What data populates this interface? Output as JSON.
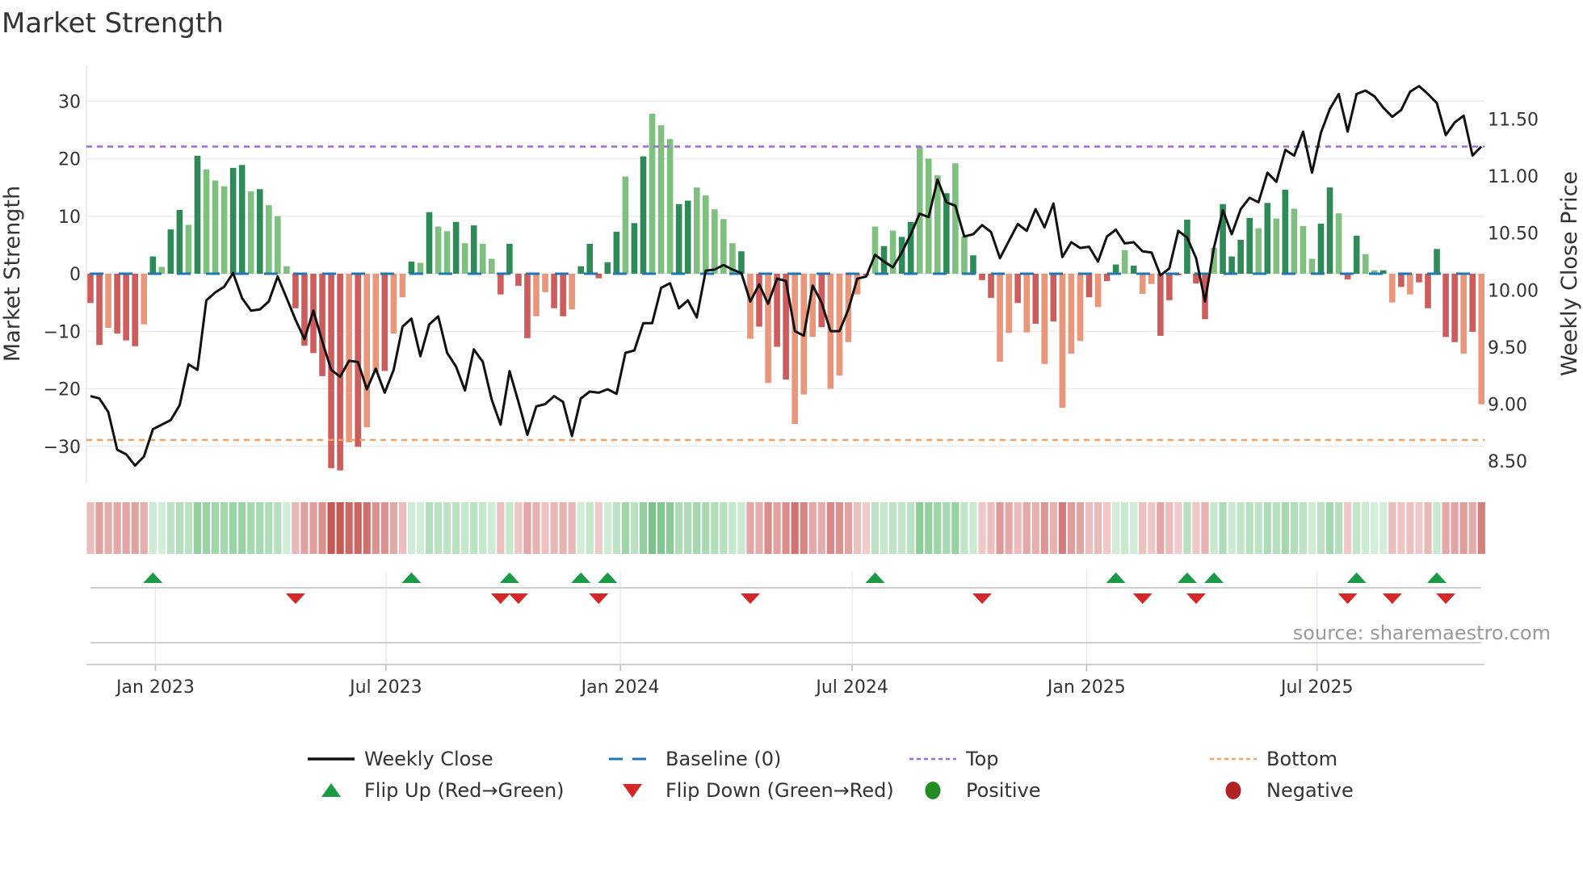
{
  "title": "Market Strength",
  "source": "source: sharemaestro.com",
  "colors": {
    "bar_pos_dark": "#2e8b57",
    "bar_pos_light": "#7fbf7f",
    "bar_neg_dark": "#cd5c5c",
    "bar_neg_light": "#e9967a",
    "close_line": "#111111",
    "baseline": "#1f77b4",
    "top": "#a066e0",
    "bottom": "#f4a460",
    "flip_up": "#1a9a45",
    "flip_down": "#d62728",
    "positive": "#228b22",
    "negative": "#b22222"
  },
  "legend": [
    {
      "key": "weekly_close",
      "label": "Weekly Close"
    },
    {
      "key": "baseline",
      "label": "Baseline (0)"
    },
    {
      "key": "top",
      "label": "Top"
    },
    {
      "key": "bottom",
      "label": "Bottom"
    },
    {
      "key": "flip_up",
      "label": "Flip Up (Red→Green)"
    },
    {
      "key": "flip_down",
      "label": "Flip Down (Green→Red)"
    },
    {
      "key": "positive",
      "label": "Positive"
    },
    {
      "key": "negative",
      "label": "Negative"
    }
  ],
  "chart_data": {
    "type": "bar",
    "title": "Market Strength",
    "ylabel": "Market Strength",
    "y2label": "Weekly Close Price",
    "ylim": [
      -36.5,
      36.5
    ],
    "y2lim": [
      8.3,
      11.9
    ],
    "start_date": "2022-11-11",
    "interval": "weekly",
    "top_level": 22.1,
    "bottom_level": -28.9,
    "baseline": 0,
    "yticks": [
      {
        "v": 30,
        "label": "30"
      },
      {
        "v": 20,
        "label": "20"
      },
      {
        "v": 10,
        "label": "10"
      },
      {
        "v": 0,
        "label": "0"
      },
      {
        "v": -10,
        "label": "−10"
      },
      {
        "v": -20,
        "label": "−20"
      },
      {
        "v": -30,
        "label": "−30"
      }
    ],
    "y2ticks": [
      {
        "v": 11.5,
        "label": "11.50"
      },
      {
        "v": 11.0,
        "label": "11.00"
      },
      {
        "v": 10.5,
        "label": "10.50"
      },
      {
        "v": 10.0,
        "label": "10.00"
      },
      {
        "v": 9.5,
        "label": "9.50"
      },
      {
        "v": 9.0,
        "label": "9.00"
      },
      {
        "v": 8.5,
        "label": "8.50"
      }
    ],
    "xticks": [
      {
        "date": "2023-01-01",
        "label": "Jan 2023"
      },
      {
        "date": "2023-07-01",
        "label": "Jul 2023"
      },
      {
        "date": "2024-01-01",
        "label": "Jan 2024"
      },
      {
        "date": "2024-07-01",
        "label": "Jul 2024"
      },
      {
        "date": "2025-01-01",
        "label": "Jan 2025"
      },
      {
        "date": "2025-07-01",
        "label": "Jul 2025"
      }
    ],
    "strength": [
      -5.1,
      -12.4,
      -9.4,
      -10.4,
      -11.6,
      -12.6,
      -8.8,
      3.0,
      1.2,
      7.7,
      11.1,
      8.5,
      20.5,
      18.1,
      16.2,
      15.2,
      18.4,
      18.9,
      14.3,
      14.7,
      11.9,
      10.0,
      1.3,
      -6.0,
      -12.5,
      -13.8,
      -17.8,
      -33.8,
      -34.2,
      -29.3,
      -30.1,
      -26.7,
      -17.0,
      -16.9,
      -10.4,
      -4.1,
      2.1,
      1.9,
      10.7,
      8.2,
      7.4,
      9.0,
      5.3,
      8.4,
      5.2,
      2.6,
      -3.6,
      5.2,
      -2.1,
      -11.2,
      -7.4,
      -3.2,
      -6.0,
      -7.4,
      -6.2,
      1.3,
      5.2,
      -0.8,
      2.0,
      7.3,
      16.9,
      8.8,
      20.4,
      27.8,
      25.8,
      23.4,
      12.1,
      12.7,
      15.0,
      13.6,
      11.2,
      9.5,
      5.3,
      3.9,
      -11.3,
      -9.2,
      -19.0,
      -12.7,
      -18.4,
      -26.1,
      -21.0,
      -11.0,
      -9.3,
      -20.0,
      -17.7,
      -11.9,
      -3.6,
      -0.3,
      8.2,
      4.8,
      7.5,
      6.4,
      9.0,
      22.1,
      20.0,
      17.1,
      14.0,
      19.2,
      6.5,
      3.2,
      -1.1,
      -4.2,
      -15.3,
      -10.3,
      -5.1,
      -10.2,
      -8.7,
      -15.7,
      -8.3,
      -23.3,
      -13.9,
      -11.7,
      -4.1,
      -5.8,
      -1.3,
      1.6,
      4.1,
      1.4,
      -3.5,
      -1.8,
      -10.8,
      -4.6,
      -0.3,
      9.4,
      -1.7,
      -7.9,
      4.5,
      12.1,
      3.0,
      5.9,
      9.7,
      7.9,
      12.3,
      9.6,
      14.6,
      11.3,
      8.3,
      2.6,
      8.7,
      15.0,
      10.5,
      -1.0,
      6.6,
      3.4,
      0.6,
      0.6,
      -5.0,
      -2.3,
      -3.6,
      -1.5,
      -6.0,
      4.3,
      -11.0,
      -11.9,
      -13.9,
      -10.1,
      -22.7
    ],
    "tone": "DDLDDDLDLDDLDLLLDDLDLLLDDDDDDLDLLDLLDLDLLDLDLLDDDDLLDDLDDDDDLDDLLLDDLLLLLDLDLDDLLLDLLLLDLDLDDLLLDLLDDDLLDLDLDLLLDLDDLDLLDDDDDDLDDDDLDLDLLLDDLDDLLDLDLDDDDDLD",
    "close": [
      9.07,
      9.05,
      8.93,
      8.6,
      8.56,
      8.46,
      8.54,
      8.78,
      8.82,
      8.86,
      8.99,
      9.35,
      9.3,
      9.91,
      9.98,
      10.03,
      10.15,
      9.93,
      9.82,
      9.83,
      9.9,
      10.12,
      9.93,
      9.74,
      9.57,
      9.82,
      9.55,
      9.3,
      9.24,
      9.38,
      9.37,
      9.13,
      9.31,
      9.1,
      9.3,
      9.68,
      9.75,
      9.42,
      9.7,
      9.77,
      9.45,
      9.33,
      9.12,
      9.48,
      9.37,
      9.04,
      8.82,
      9.29,
      9.02,
      8.73,
      8.98,
      9.0,
      9.07,
      9.02,
      8.72,
      9.05,
      9.11,
      9.1,
      9.13,
      9.09,
      9.45,
      9.47,
      9.71,
      9.71,
      10.02,
      10.06,
      9.84,
      9.91,
      9.76,
      10.17,
      10.18,
      10.22,
      10.18,
      10.15,
      9.9,
      10.05,
      9.88,
      10.1,
      10.08,
      9.64,
      9.6,
      10.04,
      9.89,
      9.64,
      9.64,
      9.83,
      10.1,
      10.12,
      10.31,
      10.25,
      10.2,
      10.33,
      10.49,
      10.67,
      10.64,
      10.97,
      10.77,
      10.74,
      10.47,
      10.49,
      10.57,
      10.51,
      10.28,
      10.43,
      10.58,
      10.52,
      10.71,
      10.55,
      10.76,
      10.29,
      10.42,
      10.37,
      10.38,
      10.25,
      10.47,
      10.53,
      10.41,
      10.42,
      10.34,
      10.33,
      10.13,
      10.19,
      10.52,
      10.46,
      10.28,
      9.9,
      10.37,
      10.7,
      10.49,
      10.71,
      10.81,
      10.77,
      11.03,
      10.95,
      11.23,
      11.18,
      11.39,
      11.03,
      11.38,
      11.59,
      11.72,
      11.39,
      11.72,
      11.75,
      11.7,
      11.6,
      11.52,
      11.58,
      11.74,
      11.79,
      11.72,
      11.64,
      11.36,
      11.47,
      11.53,
      11.18,
      11.26
    ]
  }
}
